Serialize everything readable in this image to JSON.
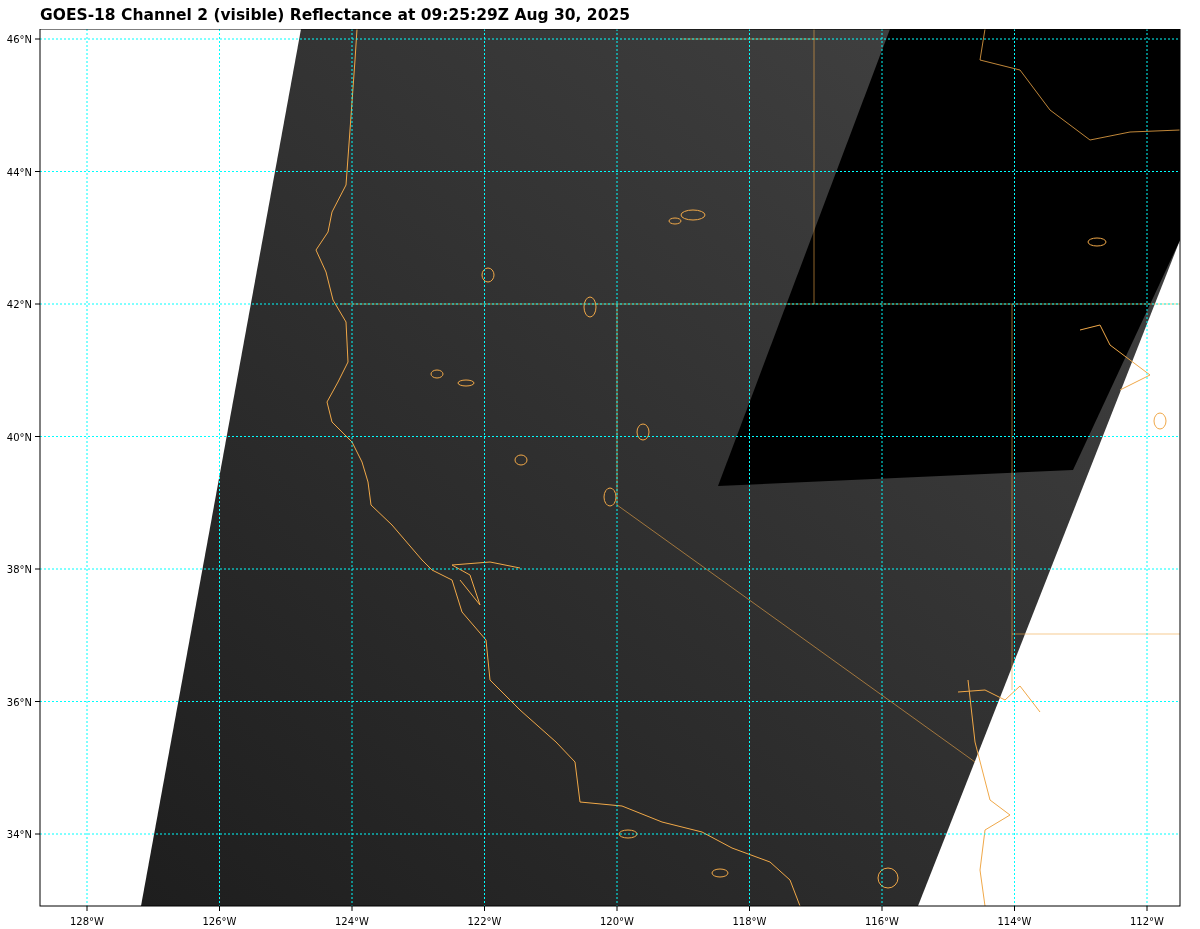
{
  "title": "GOES-18 Channel 2 (visible) Reflectance at 09:25:29Z Aug 30, 2025",
  "map": {
    "lon_labels": [
      "128°W",
      "126°W",
      "124°W",
      "122°W",
      "120°W",
      "118°W",
      "116°W",
      "114°W",
      "112°W"
    ],
    "lat_labels": [
      "46°N",
      "44°N",
      "42°N",
      "40°N",
      "38°N",
      "36°N",
      "34°N"
    ]
  }
}
